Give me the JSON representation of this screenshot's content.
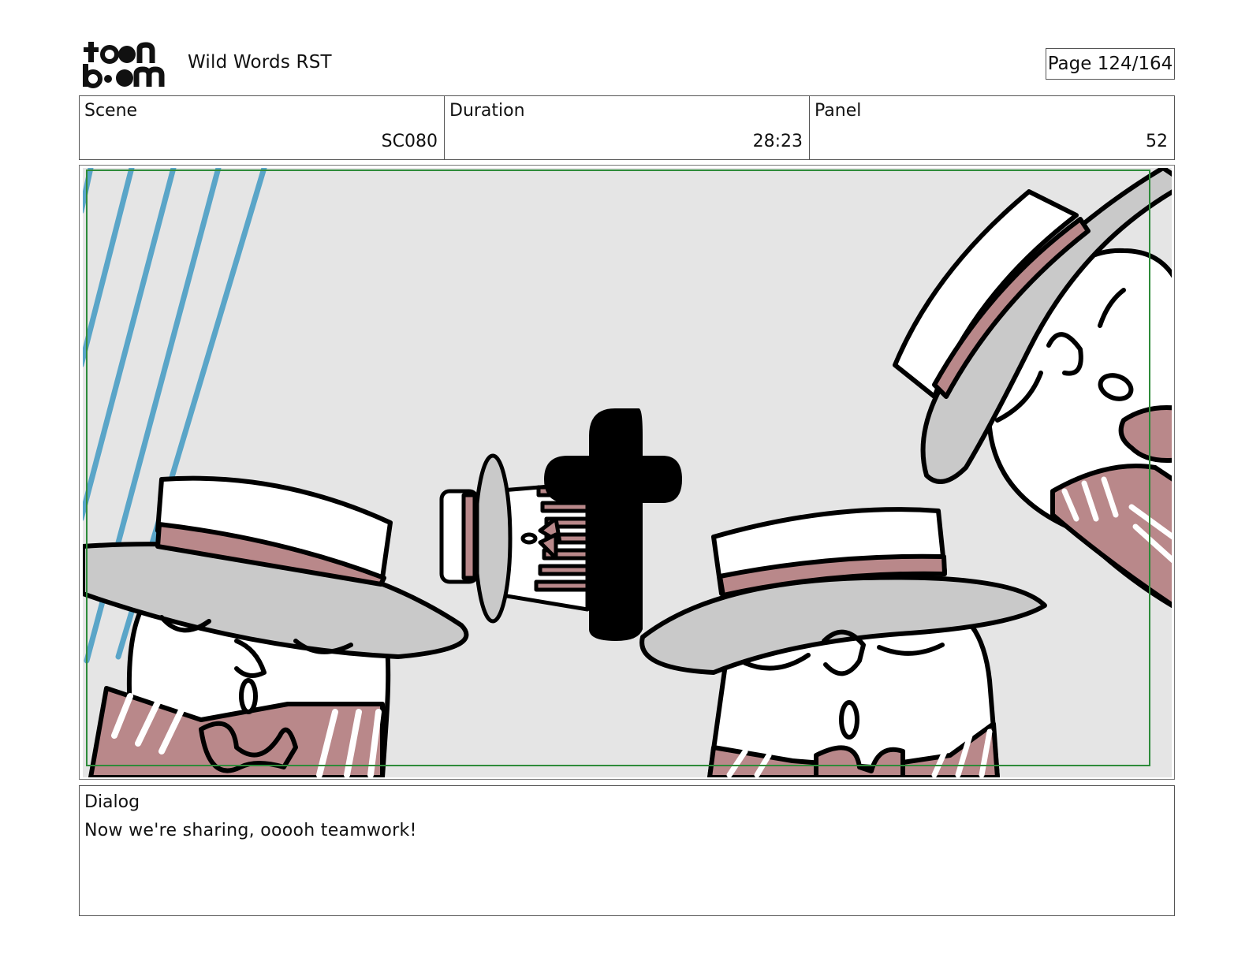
{
  "header": {
    "logo_text": "toon boom",
    "project_title": "Wild Words RST",
    "page_label": "Page 124/164"
  },
  "info": {
    "scene_label": "Scene",
    "scene_value": "SC080",
    "duration_label": "Duration",
    "duration_value": "28:23",
    "panel_label": "Panel",
    "panel_value": "52"
  },
  "panel_image": {
    "description_icon": "storyboard-drawing-icon",
    "colors": {
      "background": "#e5e5e5",
      "hat_band": "#b9888a",
      "hat_brim": "#c9c9c9",
      "motion_lines": "#5aa5c8",
      "safe_frame": "#2e8b3a"
    }
  },
  "dialog": {
    "label": "Dialog",
    "text": "Now we're sharing, ooooh teamwork!"
  }
}
